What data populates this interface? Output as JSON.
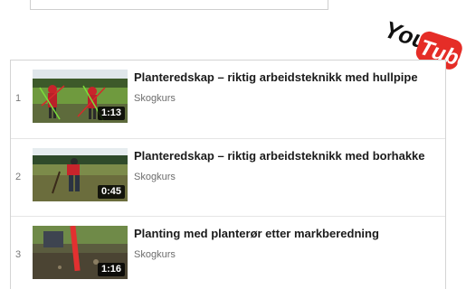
{
  "logo": {
    "brand": "YouTube",
    "icon": "youtube-logo-icon"
  },
  "playlist": {
    "items": [
      {
        "index": "1",
        "title": "Planteredskap – riktig arbeidsteknikk med hullpipe",
        "channel": "Skogkurs",
        "duration": "1:13"
      },
      {
        "index": "2",
        "title": "Planteredskap – riktig arbeidsteknikk med borhakke",
        "channel": "Skogkurs",
        "duration": "0:45"
      },
      {
        "index": "3",
        "title": "Planting med planterør etter markberedning",
        "channel": "Skogkurs",
        "duration": "1:16"
      }
    ]
  }
}
